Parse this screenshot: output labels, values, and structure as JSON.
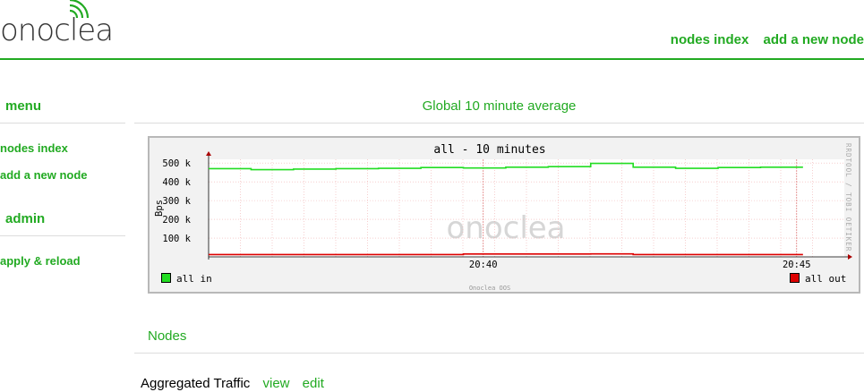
{
  "header": {
    "logo_text": "onoclea",
    "nav": [
      {
        "label": "nodes index"
      },
      {
        "label": "add a new node"
      }
    ]
  },
  "sidebar": {
    "menu_heading": "menu",
    "menu_items": [
      {
        "label": "nodes index"
      },
      {
        "label": "add a new node"
      }
    ],
    "admin_heading": "admin",
    "admin_items": [
      {
        "label": "apply & reload"
      }
    ]
  },
  "main": {
    "section_title": "Global 10 minute average",
    "nodes_heading": "Nodes",
    "node": {
      "name": "Aggregated Traffic",
      "view_label": "view",
      "edit_label": "edit"
    }
  },
  "chart_data": {
    "type": "line",
    "title": "all - 10 minutes",
    "ylabel": "Bps",
    "ylim": [
      0,
      520000
    ],
    "y_ticks": [
      "100 k",
      "200 k",
      "300 k",
      "400 k",
      "500 k"
    ],
    "x_tick_labels": [
      "20:40",
      "20:45"
    ],
    "credit": "RRDTOOL / TOBI OETIKER",
    "footer": "Onoclea OOS",
    "watermark": "onoclea",
    "grid": true,
    "series": [
      {
        "name": "all in",
        "color": "#22dd22",
        "values": [
          470000,
          465000,
          468000,
          470000,
          472000,
          476000,
          474000,
          478000,
          481000,
          498000,
          478000,
          472000,
          476000,
          478000
        ]
      },
      {
        "name": "all out",
        "color": "#dd0000",
        "values": [
          12000,
          12000,
          12000,
          12000,
          12000,
          12000,
          15000,
          15000,
          15000,
          16000,
          12000,
          12000,
          12000,
          12000
        ]
      }
    ]
  },
  "colors": {
    "accent": "#22aa22",
    "rule": "#dddddd",
    "graph_bg": "#f2f2f2",
    "plot_bg": "#ffffff"
  }
}
